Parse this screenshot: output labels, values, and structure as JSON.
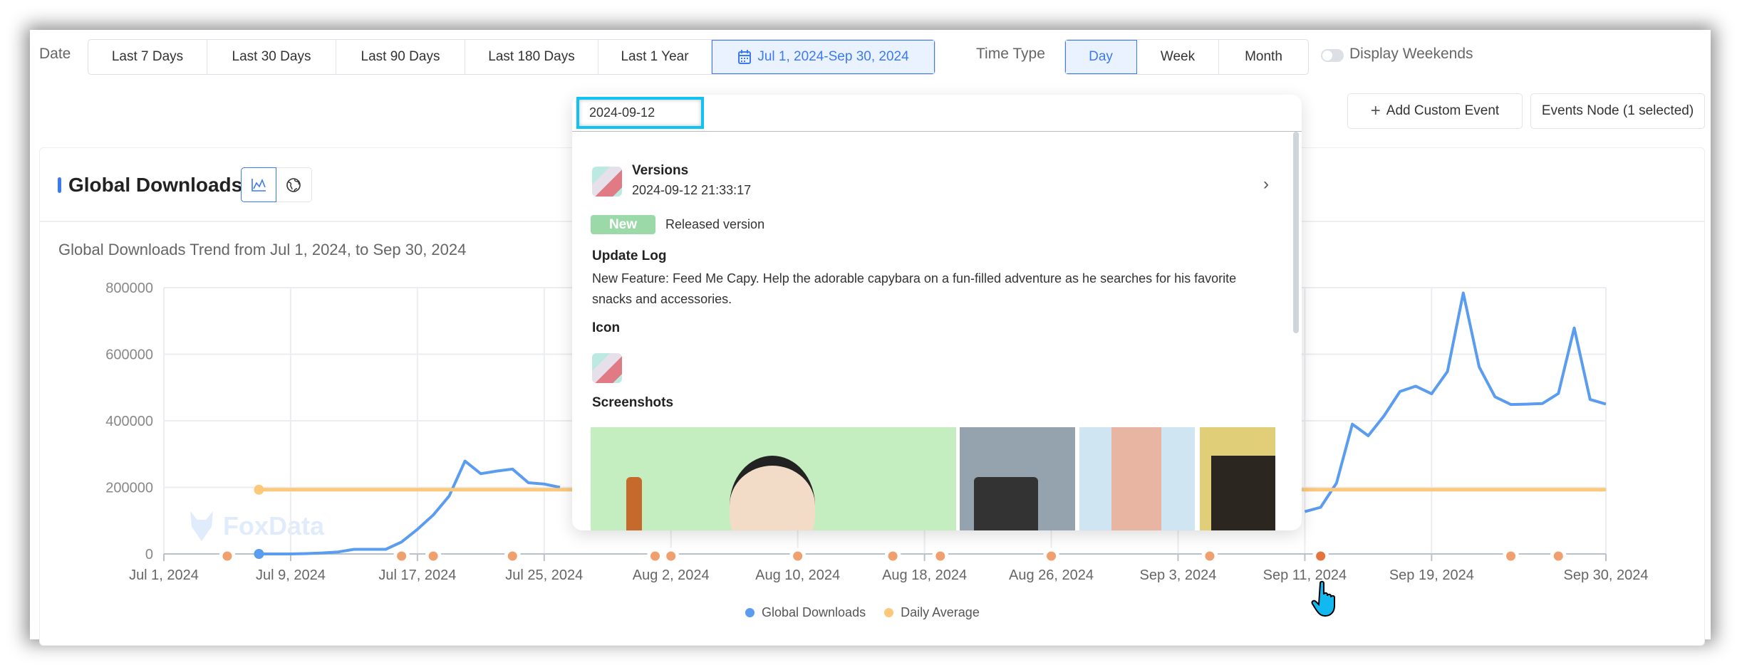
{
  "filters": {
    "date_label": "Date",
    "date_ranges": [
      "Last 7 Days",
      "Last 30 Days",
      "Last 90 Days",
      "Last 180 Days",
      "Last 1 Year"
    ],
    "custom_range": "Jul 1, 2024-Sep 30, 2024",
    "time_type_label": "Time Type",
    "time_types": [
      "Day",
      "Week",
      "Month"
    ],
    "selected_time_type": "Day",
    "display_weekends_label": "Display Weekends",
    "display_weekends": false
  },
  "actions": {
    "add_custom_event": "Add Custom Event",
    "events_node": "Events Node (1 selected)"
  },
  "card": {
    "title": "Global Downloads",
    "subtitle": "Global Downloads Trend from Jul 1, 2024, to Sep 30, 2024",
    "watermark": "FoxData"
  },
  "popup": {
    "date_value": "2024-09-12",
    "event_type": "Versions",
    "timestamp": "2024-09-12 21:33:17",
    "badge": "New",
    "badge_text": "Released version",
    "update_log_heading": "Update Log",
    "update_log": "New Feature: Feed Me Capy. Help the adorable capybara on a fun-filled adventure as he searches for his favorite snacks and accessories.",
    "icon_heading": "Icon",
    "screenshots_heading": "Screenshots"
  },
  "chart_data": {
    "type": "line",
    "xlim": [
      "2024-07-01",
      "2024-09-30"
    ],
    "ylim": [
      0,
      800000
    ],
    "y_ticks": [
      "0",
      "200000",
      "400000",
      "600000",
      "800000"
    ],
    "x_ticks": [
      {
        "date": "2024-07-01",
        "label": "Jul 1, 2024"
      },
      {
        "date": "2024-07-09",
        "label": "Jul 9, 2024"
      },
      {
        "date": "2024-07-17",
        "label": "Jul 17, 2024"
      },
      {
        "date": "2024-07-25",
        "label": "Jul 25, 2024"
      },
      {
        "date": "2024-08-02",
        "label": "Aug 2, 2024"
      },
      {
        "date": "2024-08-10",
        "label": "Aug 10, 2024"
      },
      {
        "date": "2024-08-18",
        "label": "Aug 18, 2024"
      },
      {
        "date": "2024-08-26",
        "label": "Aug 26, 2024"
      },
      {
        "date": "2024-09-03",
        "label": "Sep 3, 2024"
      },
      {
        "date": "2024-09-11",
        "label": "Sep 11, 2024"
      },
      {
        "date": "2024-09-19",
        "label": "Sep 19, 2024"
      },
      {
        "date": "2024-09-30",
        "label": "Sep 30, 2024"
      }
    ],
    "grid": true,
    "legend_position": "bottom",
    "series": [
      {
        "name": "Global Downloads",
        "color": "#5a9cf0",
        "x": [
          "2024-07-07",
          "2024-07-08",
          "2024-07-09",
          "2024-07-10",
          "2024-07-11",
          "2024-07-12",
          "2024-07-13",
          "2024-07-14",
          "2024-07-15",
          "2024-07-16",
          "2024-07-17",
          "2024-07-18",
          "2024-07-19",
          "2024-07-20",
          "2024-07-21",
          "2024-07-22",
          "2024-07-23",
          "2024-07-24",
          "2024-07-25",
          "2024-07-26",
          "2024-09-11",
          "2024-09-12",
          "2024-09-13",
          "2024-09-14",
          "2024-09-15",
          "2024-09-16",
          "2024-09-17",
          "2024-09-18",
          "2024-09-19",
          "2024-09-20",
          "2024-09-21",
          "2024-09-22",
          "2024-09-23",
          "2024-09-24",
          "2024-09-25",
          "2024-09-26",
          "2024-09-27",
          "2024-09-28",
          "2024-09-29",
          "2024-09-30"
        ],
        "values": [
          0,
          0,
          0,
          1000,
          3000,
          6000,
          14000,
          14000,
          14000,
          36000,
          74000,
          117000,
          174000,
          279000,
          241000,
          249000,
          255000,
          214000,
          210000,
          200000,
          127000,
          140000,
          213000,
          390000,
          355000,
          415000,
          488000,
          504000,
          481000,
          548000,
          784000,
          562000,
          472000,
          449000,
          450000,
          452000,
          482000,
          679000,
          464000,
          450000
        ]
      },
      {
        "name": "Daily Average",
        "color": "#fcc87a",
        "x": [
          "2024-07-07",
          "2024-09-30"
        ],
        "values": [
          193000,
          193000
        ]
      }
    ],
    "events": [
      {
        "date": "2024-07-05"
      },
      {
        "date": "2024-07-16"
      },
      {
        "date": "2024-07-18"
      },
      {
        "date": "2024-07-23"
      },
      {
        "date": "2024-08-01"
      },
      {
        "date": "2024-08-02"
      },
      {
        "date": "2024-08-10"
      },
      {
        "date": "2024-08-16"
      },
      {
        "date": "2024-08-19"
      },
      {
        "date": "2024-08-26"
      },
      {
        "date": "2024-09-05"
      },
      {
        "date": "2024-09-12",
        "selected": true
      },
      {
        "date": "2024-09-24"
      },
      {
        "date": "2024-09-27"
      }
    ],
    "event_color": "#f0a06e",
    "selected_event_color": "#e5743c"
  }
}
